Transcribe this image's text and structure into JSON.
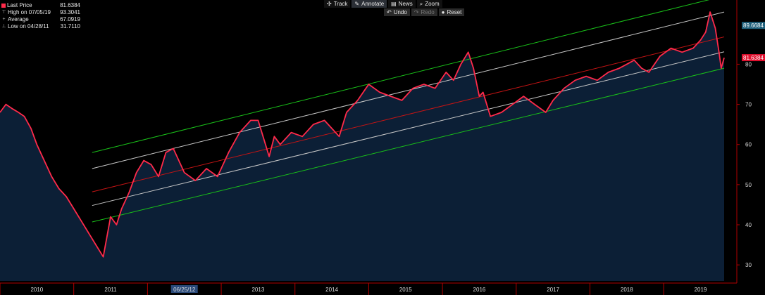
{
  "legend": {
    "items": [
      {
        "label": "Last Price",
        "value": "81.6384",
        "icon": "red-square-icon"
      },
      {
        "label": "High on 07/05/19",
        "value": "93.3041",
        "icon": "high-marker-icon"
      },
      {
        "label": "Average",
        "value": "67.0919",
        "icon": "average-marker-icon"
      },
      {
        "label": "Low on 04/28/11",
        "value": "31.7110",
        "icon": "low-marker-icon"
      }
    ]
  },
  "toolbar": {
    "track": "Track",
    "annotate": "Annotate",
    "news": "News",
    "zoom": "Zoom",
    "undo": "Undo",
    "redo": "Redo",
    "reset": "Reset"
  },
  "colors": {
    "price": "#ff2a4a",
    "area": "#0c1f36",
    "channel_outer": "#19c019",
    "channel_inner": "#c8c8c8",
    "channel_mid": "#c41414",
    "axis": "#b00000"
  },
  "chart_data": {
    "type": "area",
    "title": "",
    "ylim": [
      26,
      96
    ],
    "y_ticks": [
      30,
      40,
      50,
      60,
      70,
      80
    ],
    "x_labels": [
      "2010",
      "2011",
      "06/25/12",
      "2013",
      "2014",
      "2015",
      "2016",
      "2017",
      "2018",
      "2019"
    ],
    "series": [
      {
        "name": "Last Price",
        "x": [
          2009.5,
          2009.58,
          2009.66,
          2009.75,
          2009.83,
          2009.92,
          2010.0,
          2010.1,
          2010.2,
          2010.3,
          2010.4,
          2010.5,
          2010.6,
          2010.7,
          2010.8,
          2010.9,
          2011.0,
          2011.08,
          2011.15,
          2011.25,
          2011.35,
          2011.45,
          2011.55,
          2011.65,
          2011.75,
          2011.85,
          2012.0,
          2012.15,
          2012.3,
          2012.45,
          2012.6,
          2012.75,
          2012.9,
          2013.0,
          2013.1,
          2013.15,
          2013.22,
          2013.3,
          2013.45,
          2013.6,
          2013.75,
          2013.9,
          2014.0,
          2014.1,
          2014.2,
          2014.35,
          2014.5,
          2014.65,
          2014.8,
          2014.95,
          2015.1,
          2015.25,
          2015.4,
          2015.55,
          2015.65,
          2015.75,
          2015.85,
          2015.92,
          2016.0,
          2016.05,
          2016.15,
          2016.3,
          2016.45,
          2016.6,
          2016.75,
          2016.9,
          2017.0,
          2017.15,
          2017.3,
          2017.45,
          2017.6,
          2017.75,
          2017.9,
          2018.0,
          2018.1,
          2018.2,
          2018.3,
          2018.45,
          2018.6,
          2018.75,
          2018.9,
          2019.0,
          2019.07,
          2019.13,
          2019.2,
          2019.25,
          2019.28,
          2019.32
        ],
        "values": [
          68,
          70,
          69,
          68,
          67,
          64,
          60,
          56,
          52,
          49,
          47,
          44,
          41,
          38,
          35,
          32,
          42,
          40,
          44,
          48,
          53,
          56,
          55,
          52,
          58,
          59,
          53,
          51,
          54,
          52,
          58,
          63,
          66,
          66,
          60,
          57,
          62,
          60,
          63,
          62,
          65,
          66,
          64,
          62,
          68,
          71,
          75,
          73,
          72,
          71,
          74,
          75,
          74,
          78,
          76,
          80,
          83,
          79,
          72,
          73,
          67,
          68,
          70,
          72,
          70,
          68,
          71,
          74,
          76,
          77,
          76,
          78,
          79,
          80,
          81,
          79,
          78,
          82,
          84,
          83,
          84,
          86,
          88,
          93,
          89,
          83,
          79,
          81.6
        ]
      }
    ],
    "labels": [
      {
        "text": "89.6684",
        "value": 89.6684
      },
      {
        "text": "81.6384",
        "value": 81.6384
      }
    ],
    "channel": {
      "x": [
        2010.75,
        2019.32
      ],
      "outer_upper": [
        58.0,
        97.0
      ],
      "inner_upper": [
        54.0,
        93.0
      ],
      "mid": [
        48.2,
        86.8
      ],
      "inner_lower": [
        44.8,
        83.1
      ],
      "outer_lower": [
        40.7,
        79.0
      ]
    }
  }
}
